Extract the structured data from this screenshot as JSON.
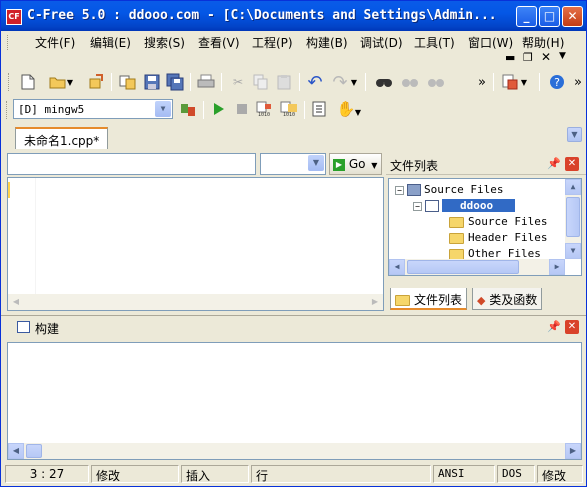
{
  "window": {
    "title": "C-Free 5.0 : ddooo.com - [C:\\Documents and Settings\\Admin...",
    "icon_text": "CF",
    "controls": {
      "minimize": "_",
      "maximize": "□",
      "close": "✕"
    }
  },
  "menu": [
    "文件(F)",
    "编辑(E)",
    "搜索(S)",
    "查看(V)",
    "工程(P)",
    "构建(B)",
    "调试(D)",
    "工具(T)",
    "窗口(W)",
    "帮助(H)"
  ],
  "toolbar": {
    "icons": [
      "new-file-icon",
      "open-folder-icon",
      "open-recent-icon",
      "copy-files-icon",
      "save-icon",
      "save-all-icon",
      "print-icon",
      "cut-icon",
      "copy-icon",
      "paste-icon",
      "undo-icon",
      "redo-icon",
      "find-icon",
      "find-next-icon",
      "find-prev-icon",
      "insert-icon",
      "help-icon"
    ],
    "overflow": "»"
  },
  "compiler": {
    "selected": "[D] mingw5"
  },
  "run_toolbar": {
    "icons": [
      "rebuild-icon",
      "run-icon",
      "stop-icon",
      "compile-icon",
      "build-icon",
      "project-icon",
      "hand-icon"
    ]
  },
  "editor": {
    "tab_label": "未命名1.cpp*",
    "go_label": "Go",
    "code_text": ""
  },
  "side_panel": {
    "title": "文件列表",
    "tree": [
      {
        "label": "Source Files",
        "level": 0
      },
      {
        "label": "ddooo",
        "level": 1,
        "selected": true
      },
      {
        "label": "Source Files",
        "level": 2
      },
      {
        "label": "Header Files",
        "level": 2
      },
      {
        "label": "Other Files",
        "level": 2
      }
    ],
    "tabs": [
      "文件列表",
      "类及函数"
    ]
  },
  "build_panel": {
    "title": "构建",
    "output": ""
  },
  "statusbar": {
    "position": "3 : 27",
    "modified": "修改",
    "insert_mode": "插入",
    "line_label": "行",
    "encoding": "ANSI",
    "line_endings": "DOS",
    "mode": "修改"
  },
  "colors": {
    "titlebar": "#0457e6",
    "accent": "#e68b2c",
    "close": "#d9422a"
  }
}
